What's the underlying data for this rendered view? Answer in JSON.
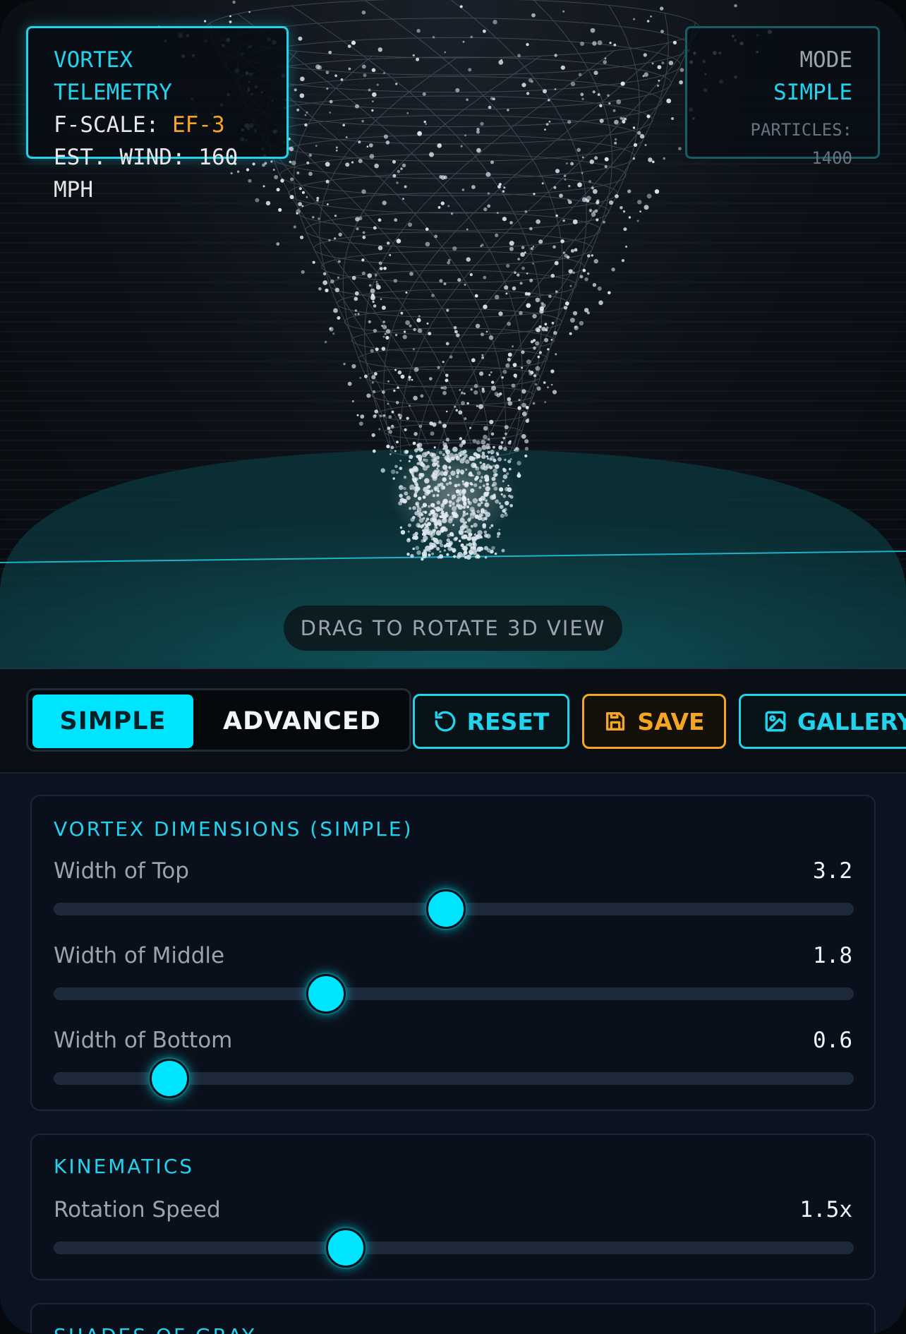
{
  "telemetry": {
    "title": "VORTEX TELEMETRY",
    "fscale_label": "F-SCALE: ",
    "fscale_value": "EF-3",
    "wind": "EST. WIND: 160 MPH"
  },
  "mode_box": {
    "label": "MODE",
    "value": "SIMPLE",
    "particles": "PARTICLES: 1400"
  },
  "viewport": {
    "hint": "DRAG TO ROTATE 3D VIEW"
  },
  "toolbar": {
    "simple_label": "SIMPLE",
    "advanced_label": "ADVANCED",
    "reset_label": "RESET",
    "save_label": "SAVE",
    "gallery_label": "GALLERY"
  },
  "dimensions": {
    "title": "VORTEX DIMENSIONS (SIMPLE)",
    "sliders": [
      {
        "label": "Width of Top",
        "value": "3.2",
        "fraction": 0.49
      },
      {
        "label": "Width of Middle",
        "value": "1.8",
        "fraction": 0.34
      },
      {
        "label": "Width of Bottom",
        "value": "0.6",
        "fraction": 0.145
      }
    ]
  },
  "kinematics": {
    "title": "KINEMATICS",
    "sliders": [
      {
        "label": "Rotation Speed",
        "value": "1.5x",
        "fraction": 0.365
      }
    ]
  },
  "next_section": {
    "title": "SHADES OF GRAY"
  },
  "colors": {
    "accent": "#00e5ff",
    "warning": "#f5a524",
    "panel": "#0a101b"
  }
}
